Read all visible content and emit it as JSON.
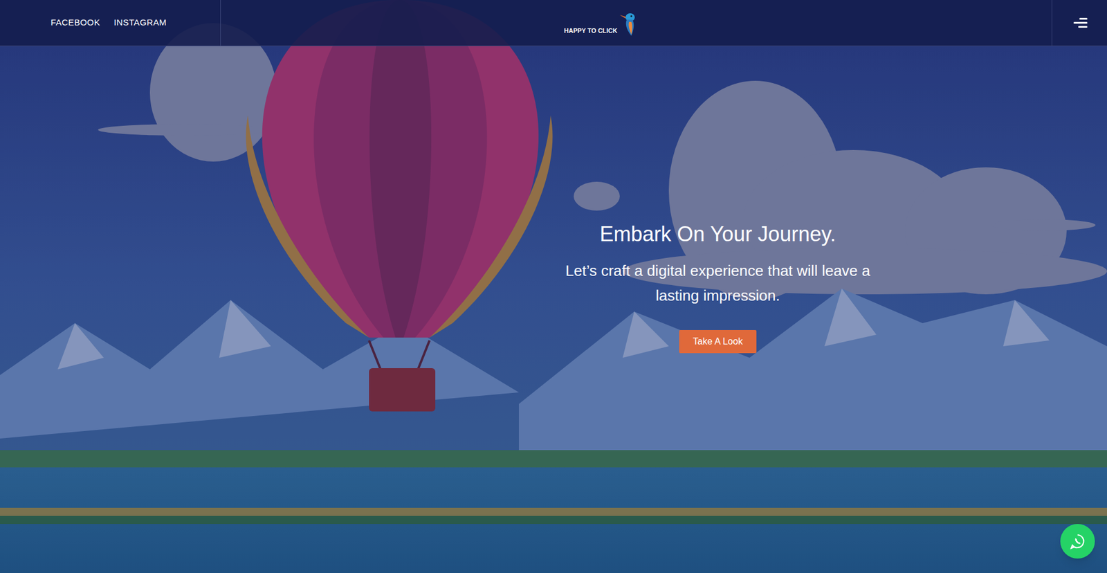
{
  "header": {
    "social_links": [
      "FACEBOOK",
      "INSTAGRAM"
    ],
    "logo": "HAPPY TO CLICK",
    "menu_icon": "menu"
  },
  "hero": {
    "heading": "Embark On Your Journey.",
    "subtitle": "Let’s craft a digital experience that will leave a lasting impression.",
    "button": "Take A Look"
  },
  "floating_button": {
    "label": "whatsapp"
  }
}
